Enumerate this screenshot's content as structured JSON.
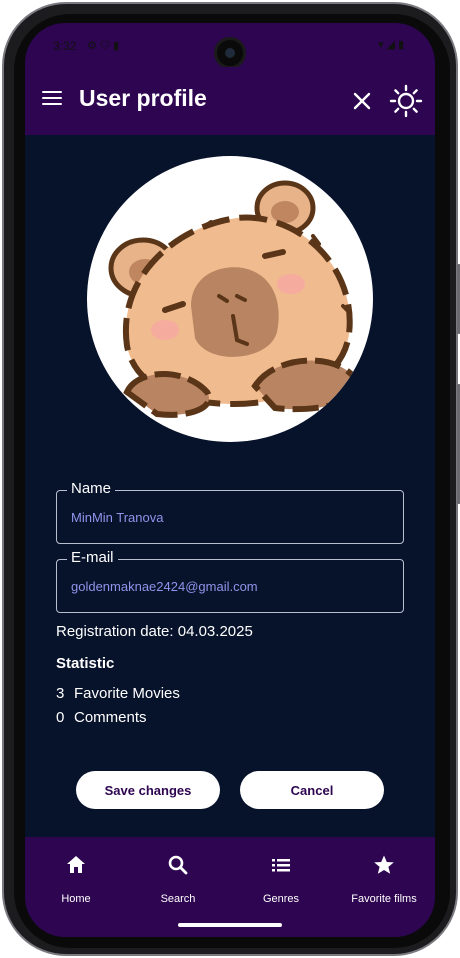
{
  "status_bar": {
    "time": "3:32",
    "left_icons": [
      "settings-icon",
      "shield-icon",
      "sim-icon"
    ],
    "right_icons": [
      "wifi-icon",
      "signal-icon",
      "battery-icon"
    ]
  },
  "app_bar": {
    "title": "User profile",
    "menu_icon": "menu-icon",
    "close_icon": "close-icon",
    "theme_icon": "sun-icon"
  },
  "profile": {
    "avatar": "capybara-avatar",
    "name_label": "Name",
    "name_value": "MinMin Tranova",
    "email_label": "E-mail",
    "email_value": "goldenmaknae2424@gmail.com",
    "registration": "Registration date: 04.03.2025",
    "statistic_title": "Statistic",
    "stats": [
      {
        "count": "3",
        "label": "Favorite Movies"
      },
      {
        "count": "0",
        "label": "Comments"
      }
    ]
  },
  "actions": {
    "save_label": "Save changes",
    "cancel_label": "Cancel"
  },
  "bottom_nav": {
    "items": [
      {
        "label": "Home",
        "icon": "home-icon"
      },
      {
        "label": "Search",
        "icon": "search-icon"
      },
      {
        "label": "Genres",
        "icon": "list-icon"
      },
      {
        "label": "Favorite films",
        "icon": "star-icon"
      }
    ]
  },
  "colors": {
    "primary": "#2d0550",
    "background": "#07122b",
    "accent_text": "#8f94ea",
    "on_primary": "#ffffff"
  }
}
